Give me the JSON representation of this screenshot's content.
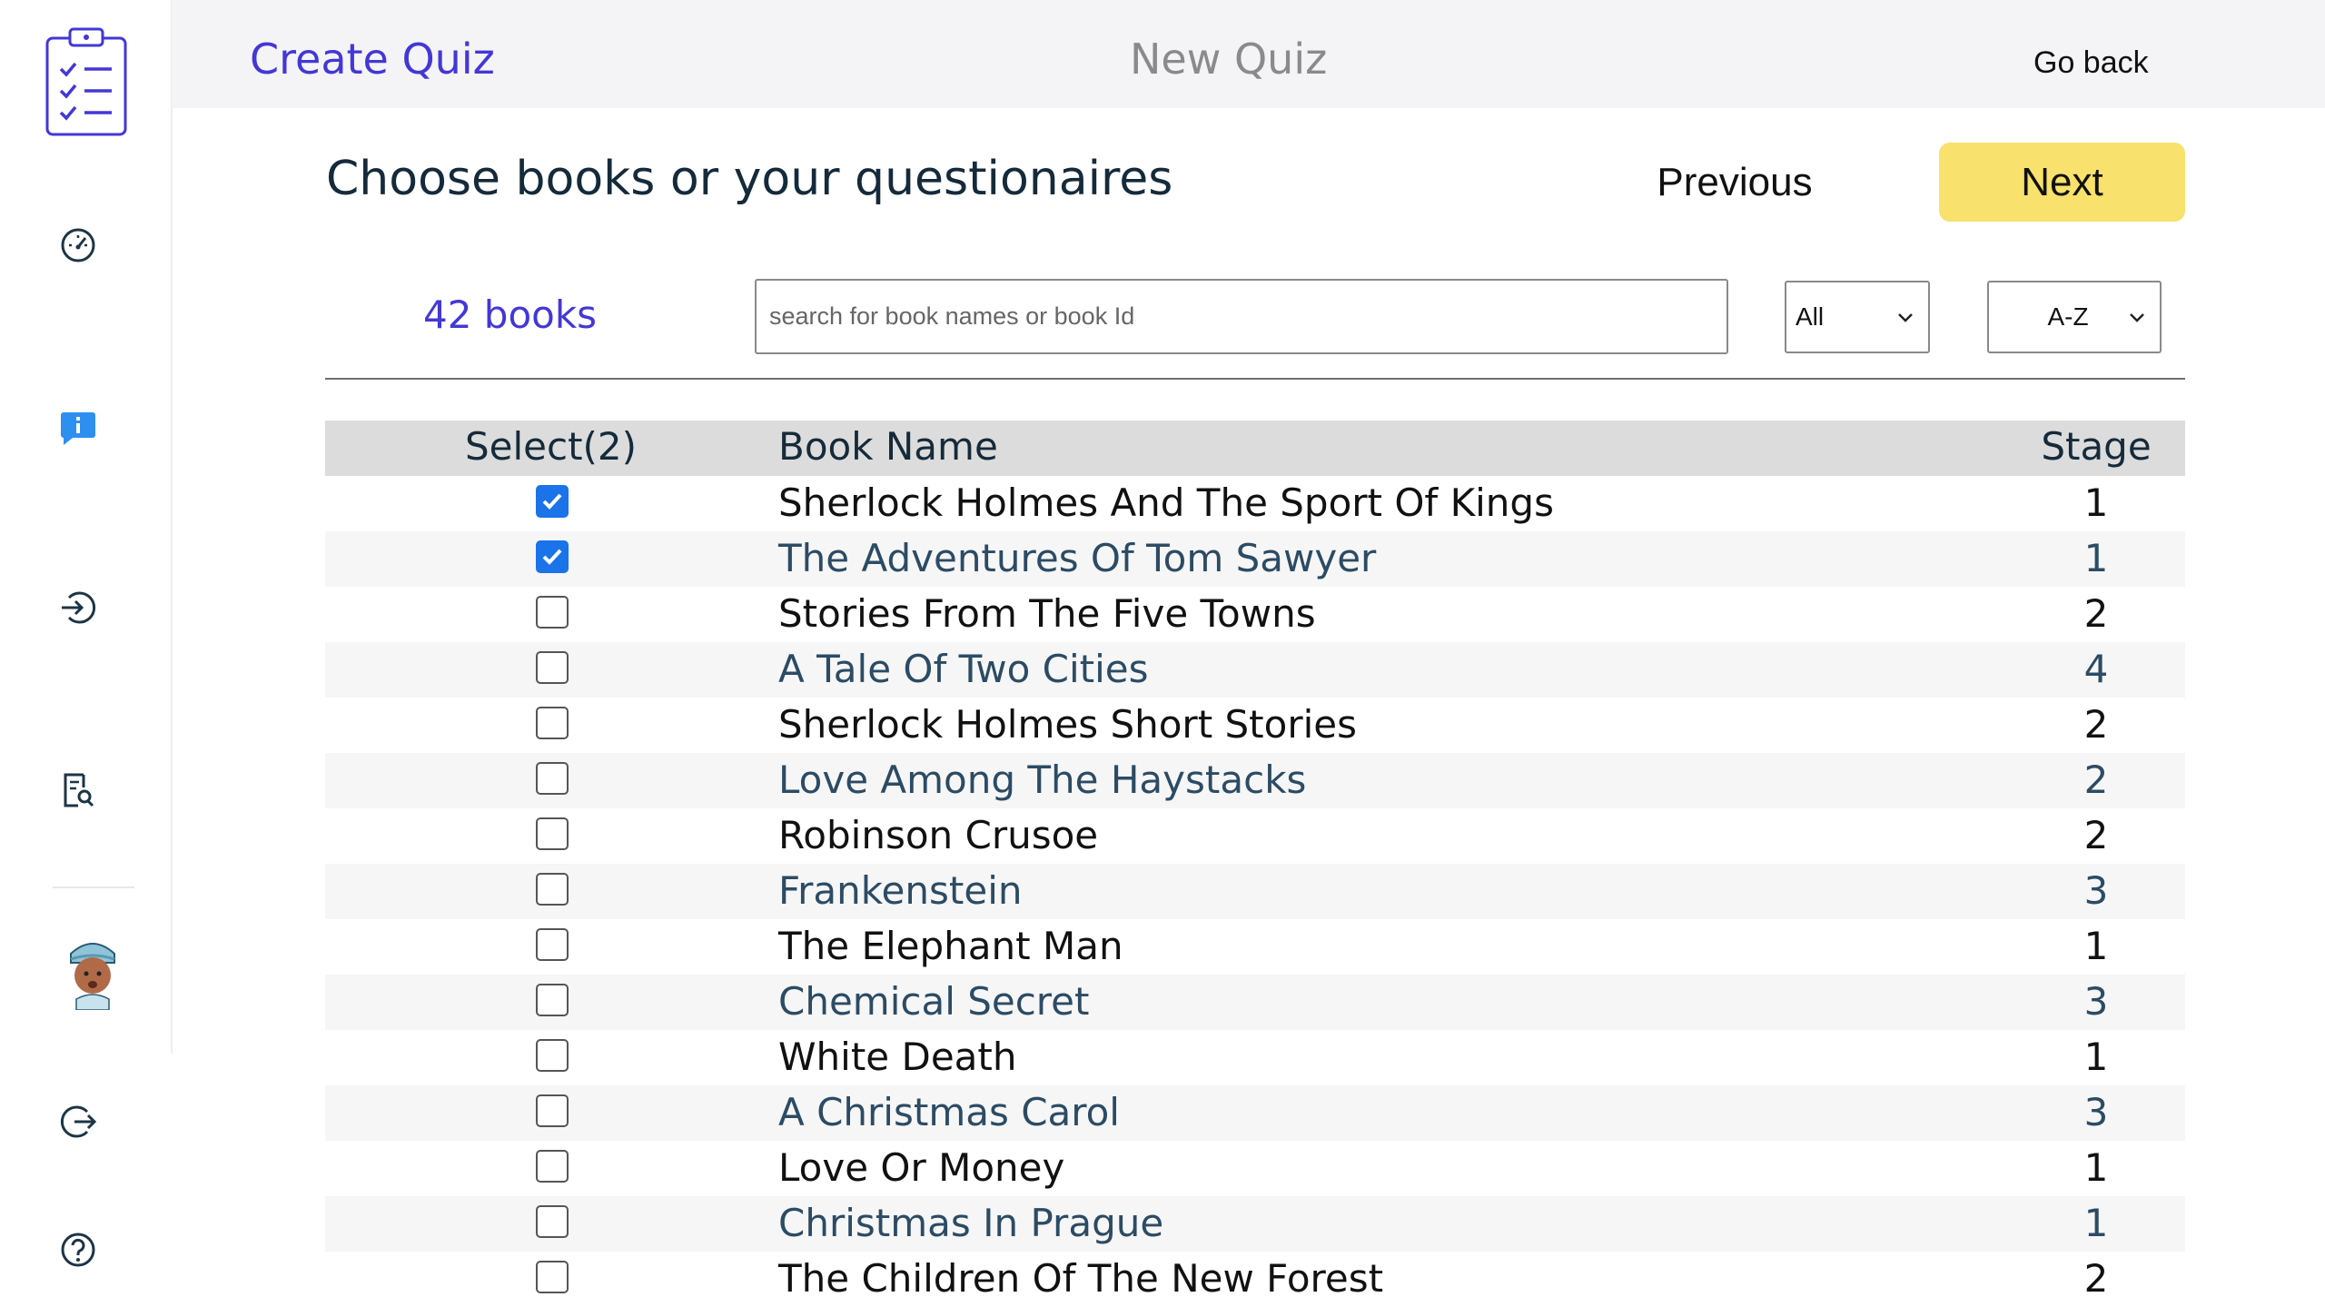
{
  "header": {
    "title": "Create Quiz",
    "center_title": "New Quiz",
    "go_back_label": "Go back"
  },
  "sidebar": {
    "items": [
      {
        "icon": "clipboard-checklist-icon"
      },
      {
        "icon": "dashboard-gauge-icon"
      },
      {
        "icon": "info-chat-icon"
      },
      {
        "icon": "login-icon"
      },
      {
        "icon": "report-search-icon"
      },
      {
        "icon": "avatar"
      },
      {
        "icon": "logout-icon"
      },
      {
        "icon": "help-icon"
      }
    ]
  },
  "main": {
    "heading": "Choose books or your questionaires",
    "previous_label": "Previous",
    "next_label": "Next",
    "book_count": "42 books",
    "search_placeholder": "search for book names or book Id",
    "filter_value": "All",
    "sort_value": "A-Z"
  },
  "table": {
    "headers": {
      "select": "Select(2)",
      "name": "Book Name",
      "stage": "Stage"
    },
    "rows": [
      {
        "name": "Sherlock Holmes And The Sport Of Kings",
        "stage": "1",
        "checked": true
      },
      {
        "name": "The Adventures Of Tom Sawyer",
        "stage": "1",
        "checked": true
      },
      {
        "name": "Stories From The Five Towns",
        "stage": "2",
        "checked": false
      },
      {
        "name": "A Tale Of Two Cities",
        "stage": "4",
        "checked": false
      },
      {
        "name": "Sherlock Holmes Short Stories",
        "stage": "2",
        "checked": false
      },
      {
        "name": "Love Among The Haystacks",
        "stage": "2",
        "checked": false
      },
      {
        "name": "Robinson Crusoe",
        "stage": "2",
        "checked": false
      },
      {
        "name": "Frankenstein",
        "stage": "3",
        "checked": false
      },
      {
        "name": "The Elephant Man",
        "stage": "1",
        "checked": false
      },
      {
        "name": "Chemical Secret",
        "stage": "3",
        "checked": false
      },
      {
        "name": "White Death",
        "stage": "1",
        "checked": false
      },
      {
        "name": "A Christmas Carol",
        "stage": "3",
        "checked": false
      },
      {
        "name": "Love Or Money",
        "stage": "1",
        "checked": false
      },
      {
        "name": "Christmas In Prague",
        "stage": "1",
        "checked": false
      },
      {
        "name": "The Children Of The New Forest",
        "stage": "2",
        "checked": false
      }
    ]
  },
  "colors": {
    "accent": "#4337d6",
    "next_button": "#f8e16c",
    "checkbox_checked": "#1a73e8",
    "alt_row_text": "#2c4b64"
  }
}
